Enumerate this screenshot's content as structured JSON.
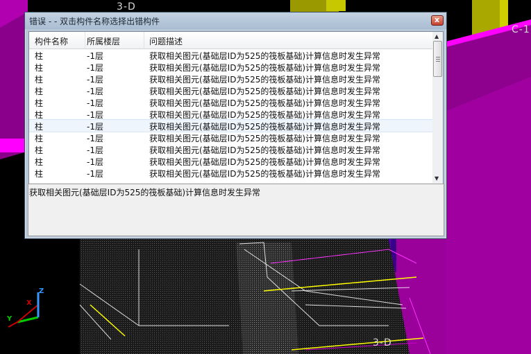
{
  "dialog": {
    "title": "错误 - - 双击构件名称选择出错构件",
    "close_label": "x"
  },
  "list": {
    "columns": [
      "构件名称",
      "所属楼层",
      "问题描述"
    ],
    "rows": [
      {
        "name": "柱",
        "floor": "-1层",
        "desc": "获取相关图元(基础层ID为525的筏板基础)计算信息时发生异常"
      },
      {
        "name": "柱",
        "floor": "-1层",
        "desc": "获取相关图元(基础层ID为525的筏板基础)计算信息时发生异常"
      },
      {
        "name": "柱",
        "floor": "-1层",
        "desc": "获取相关图元(基础层ID为525的筏板基础)计算信息时发生异常"
      },
      {
        "name": "柱",
        "floor": "-1层",
        "desc": "获取相关图元(基础层ID为525的筏板基础)计算信息时发生异常"
      },
      {
        "name": "柱",
        "floor": "-1层",
        "desc": "获取相关图元(基础层ID为525的筏板基础)计算信息时发生异常"
      },
      {
        "name": "柱",
        "floor": "-1层",
        "desc": "获取相关图元(基础层ID为525的筏板基础)计算信息时发生异常"
      },
      {
        "name": "柱",
        "floor": "-1层",
        "desc": "获取相关图元(基础层ID为525的筏板基础)计算信息时发生异常",
        "selected": true
      },
      {
        "name": "柱",
        "floor": "-1层",
        "desc": "获取相关图元(基础层ID为525的筏板基础)计算信息时发生异常"
      },
      {
        "name": "柱",
        "floor": "-1层",
        "desc": "获取相关图元(基础层ID为525的筏板基础)计算信息时发生异常"
      },
      {
        "name": "柱",
        "floor": "-1层",
        "desc": "获取相关图元(基础层ID为525的筏板基础)计算信息时发生异常"
      },
      {
        "name": "柱",
        "floor": "-1层",
        "desc": "获取相关图元(基础层ID为525的筏板基础)计算信息时发生异常"
      }
    ]
  },
  "detail": {
    "text": "获取相关图元(基础层ID为525的筏板基础)计算信息时发生异常"
  },
  "viewport": {
    "labels": [
      "3-D",
      "3-D",
      "C-1"
    ],
    "axes": [
      "Z",
      "Y",
      "X"
    ],
    "colors": {
      "magenta": "#cc00cc",
      "purple": "#6600cc",
      "olive": "#b7b700",
      "white_line": "#ffffff",
      "yellow_line": "#ffff00"
    }
  },
  "icons": {
    "close": "close-icon",
    "scroll_up": "scroll-up-arrow-icon",
    "scroll_down": "scroll-down-arrow-icon",
    "scroll_left": "scroll-left-arrow-icon",
    "scroll_right": "scroll-right-arrow-icon",
    "axis": "axis-gizmo-icon"
  }
}
